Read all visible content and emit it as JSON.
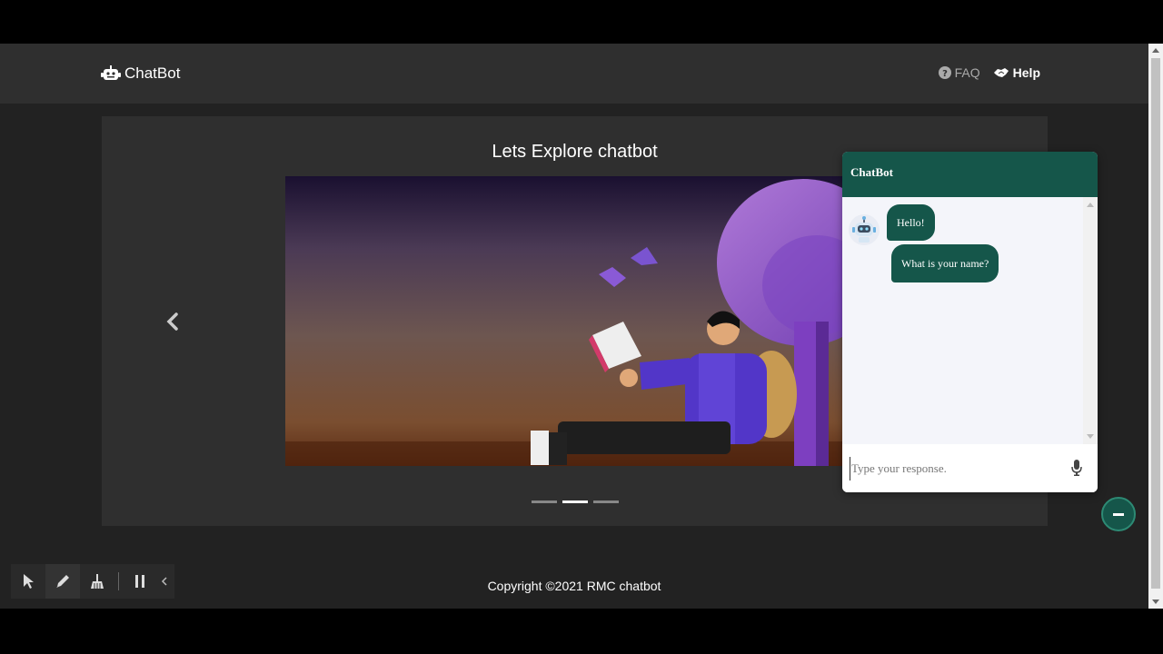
{
  "navbar": {
    "brand": "ChatBot",
    "faq_label": "FAQ",
    "help_label": "Help"
  },
  "hero": {
    "title": "Lets Explore chatbot",
    "slide_count": 3,
    "active_slide": 2
  },
  "footer": {
    "copyright": "Copyright ©2021 RMC chatbot"
  },
  "chat": {
    "header_title": "ChatBot",
    "messages": [
      {
        "sender": "bot",
        "text": "Hello!"
      },
      {
        "sender": "bot",
        "text": "What is your name?"
      }
    ],
    "input_placeholder": "Type your response."
  },
  "toolbar": {
    "tools": [
      "pointer-icon",
      "pencil-icon",
      "broom-icon",
      "pause-icon"
    ]
  },
  "colors": {
    "accent": "#15564a",
    "background": "#222222",
    "navbar": "#2f2f2f"
  }
}
